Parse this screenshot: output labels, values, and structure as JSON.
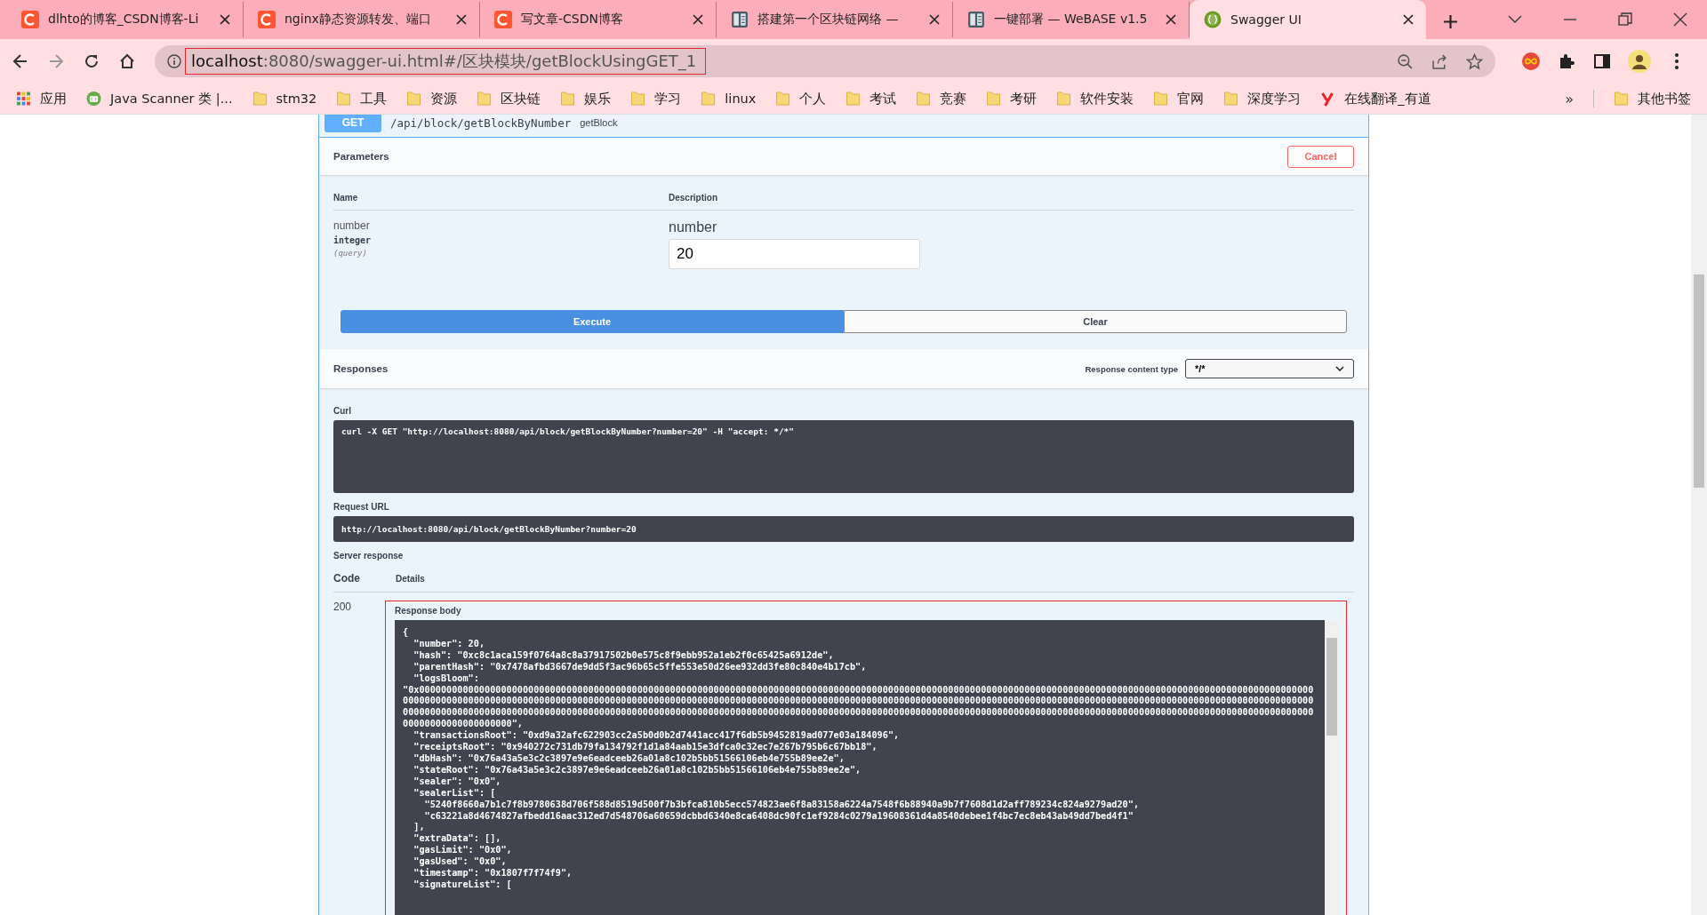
{
  "browser": {
    "tabs": [
      {
        "title": "dlhto的博客_CSDN博客-Li",
        "kind": "blog",
        "selected": false
      },
      {
        "title": "nginx静态资源转发、端口",
        "kind": "blog",
        "selected": false
      },
      {
        "title": "写文章-CSDN博客",
        "kind": "blog",
        "selected": false
      },
      {
        "title": "搭建第一个区块链网络 —",
        "kind": "doc",
        "selected": false
      },
      {
        "title": "一键部署 — WeBASE v1.5",
        "kind": "doc",
        "selected": false
      },
      {
        "title": "Swagger UI",
        "kind": "app",
        "selected": true
      }
    ],
    "address": {
      "host": "localhost",
      "path": ":8080/swagger-ui.html#/区块模块/getBlockUsingGET_1"
    },
    "bookmarks": [
      {
        "label": "应用",
        "kind": "apps"
      },
      {
        "label": "Java Scanner 类 |...",
        "kind": "page"
      },
      {
        "label": "stm32",
        "kind": "folder"
      },
      {
        "label": "工具",
        "kind": "folder"
      },
      {
        "label": "资源",
        "kind": "folder"
      },
      {
        "label": "区块链",
        "kind": "folder"
      },
      {
        "label": "娱乐",
        "kind": "folder"
      },
      {
        "label": "学习",
        "kind": "folder"
      },
      {
        "label": "linux",
        "kind": "folder"
      },
      {
        "label": "个人",
        "kind": "folder"
      },
      {
        "label": "考试",
        "kind": "folder"
      },
      {
        "label": "竞赛",
        "kind": "folder"
      },
      {
        "label": "考研",
        "kind": "folder"
      },
      {
        "label": "软件安装",
        "kind": "folder"
      },
      {
        "label": "官网",
        "kind": "folder"
      },
      {
        "label": "深度学习",
        "kind": "folder"
      },
      {
        "label": "在线翻译_有道",
        "kind": "translator"
      }
    ],
    "more": "»",
    "other_bookmarks": "其他书签"
  },
  "operation": {
    "method": "GET",
    "path": "/api/block/getBlockByNumber",
    "summary": "getBlock",
    "parameters_title": "Parameters",
    "cancel": "Cancel",
    "columns": [
      "Name",
      "Description"
    ],
    "parameter": {
      "name": "number",
      "type": "integer",
      "in": "(query)",
      "description": "number",
      "value": "20"
    },
    "execute": "Execute",
    "clear": "Clear",
    "responses_title": "Responses",
    "content_type_label": "Response content type",
    "content_type": "*/*",
    "curl_label": "Curl",
    "curl": "curl -X GET \"http://localhost:8080/api/block/getBlockByNumber?number=20\" -H \"accept: */*\"",
    "request_url_label": "Request URL",
    "request_url": "http://localhost:8080/api/block/getBlockByNumber?number=20",
    "server_response_label": "Server response",
    "code_header": "Code",
    "details_header": "Details",
    "code": "200",
    "response_body_label": "Response body",
    "response_body": [
      "{",
      "  \"number\": 20,",
      "  \"hash\": \"0xc8c1aca159f0764a8c8a37917502b0e575c8f9ebb952a1eb2f0c65425a6912de\",",
      "  \"parentHash\": \"0x7478afbd3667de9dd5f3ac96b65c5ffe553e50d26ee932dd3fe80c840e4b17cb\",",
      "  \"logsBloom\":",
      "\"0x00000000000000000000000000000000000000000000000000000000000000000000000000000000000000000000000000000000000000000000000000000000000000000000000000000000000000000000000000000000000000000000000000000000000000000000000000000000000000000000000000000000000000000000000000000000000000000000000000000000000000000000000000000000000000000000000000000000000000000000000000000000000000000000000000000000000000000000000000000000000000000000000000000000000000000000000000000000000000000000000000000000000000000000000000000000000000\",",
      "  \"transactionsRoot\": \"0xd9a32afc622903cc2a5b0d0b2d7441acc417f6db5b9452819ad077e03a184096\",",
      "  \"receiptsRoot\": \"0x940272c731db79fa134792f1d1a84aab15e3dfca0c32ec7e267b795b6c67bb18\",",
      "  \"dbHash\": \"0x76a43a5e3c2c3897e9e6eadceeb26a01a8c102b5bb51566106eb4e755b89ee2e\",",
      "  \"stateRoot\": \"0x76a43a5e3c2c3897e9e6eadceeb26a01a8c102b5bb51566106eb4e755b89ee2e\",",
      "  \"sealer\": \"0x0\",",
      "  \"sealerList\": [",
      "    \"5240f8660a7b1c7f8b9780638d706f588d8519d500f7b3bfca810b5ecc574823ae6f8a83158a6224a7548f6b88940a9b7f7608d1d2aff789234c824a9279ad20\",",
      "    \"c63221a8d4674827afbedd16aac312ed7d548706a60659dcbbd6340e8ca6408dc90fc1ef9284c0279a19608361d4a8540debee1f4bc7ec8eb43ab49dd7bed4f1\"",
      "  ],",
      "  \"extraData\": [],",
      "  \"gasLimit\": \"0x0\",",
      "  \"gasUsed\": \"0x0\",",
      "  \"timestamp\": \"0x1807f7f74f9\",",
      "  \"signatureList\": ["
    ]
  }
}
